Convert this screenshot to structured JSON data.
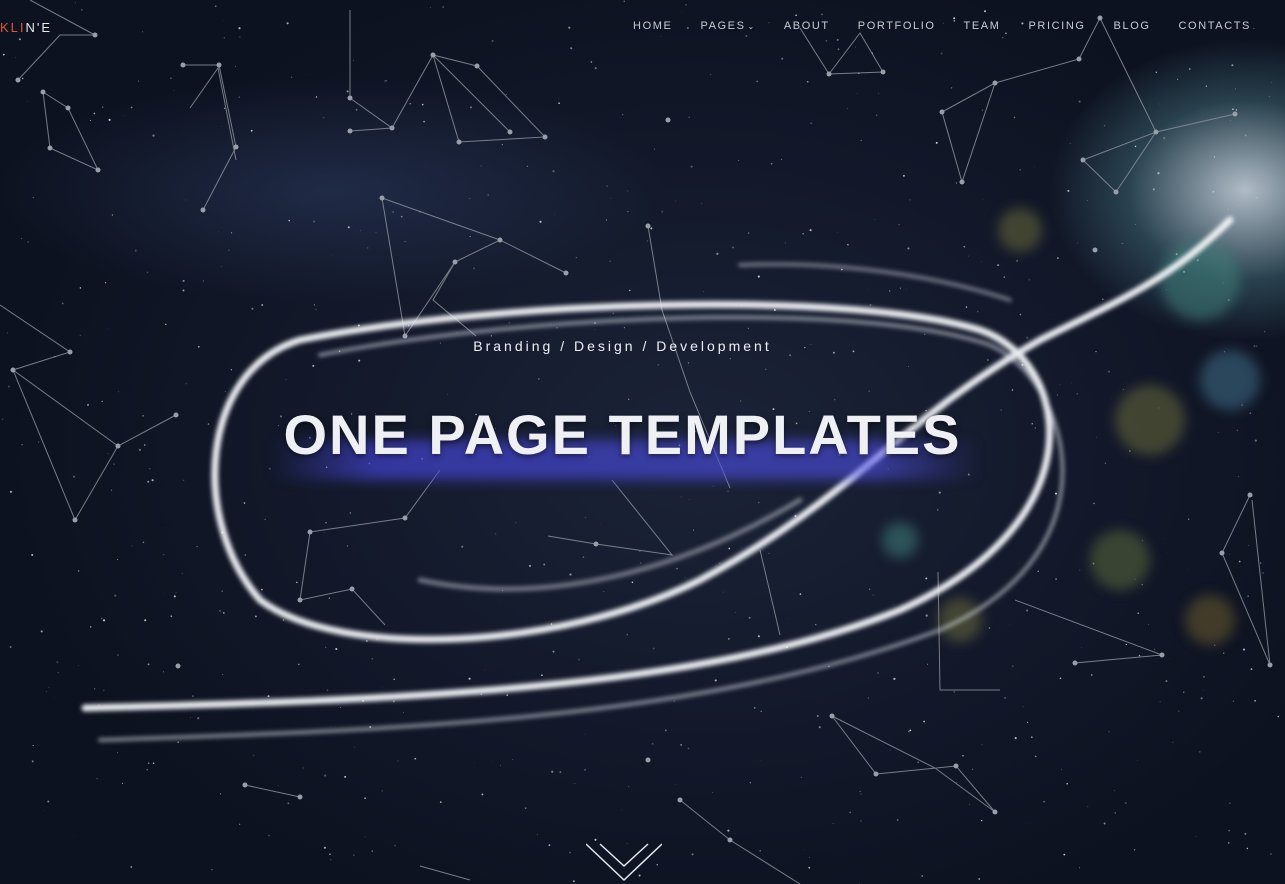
{
  "logo": {
    "prefix": "",
    "accent": "KLI",
    "suffix": "N'E"
  },
  "nav": {
    "items": [
      {
        "label": "HOME",
        "name": "nav-home",
        "has_dropdown": false
      },
      {
        "label": "PAGES",
        "name": "nav-pages",
        "has_dropdown": true
      },
      {
        "label": "ABOUT",
        "name": "nav-about",
        "has_dropdown": false
      },
      {
        "label": "PORTFOLIO",
        "name": "nav-portfolio",
        "has_dropdown": false
      },
      {
        "label": "TEAM",
        "name": "nav-team",
        "has_dropdown": false
      },
      {
        "label": "PRICING",
        "name": "nav-pricing",
        "has_dropdown": false
      },
      {
        "label": "BLOG",
        "name": "nav-blog",
        "has_dropdown": false
      },
      {
        "label": "CONTACTS",
        "name": "nav-contacts",
        "has_dropdown": false
      }
    ],
    "dropdown_icon": "chevron-down-icon"
  },
  "hero": {
    "subtitle": "Branding / Design / Development",
    "title": "ONE PAGE TEMPLATES",
    "scroll_icon": "chevron-down-icon"
  },
  "colors": {
    "accent": "#e2562c",
    "text": "#eef0f4",
    "background": "#121829"
  }
}
